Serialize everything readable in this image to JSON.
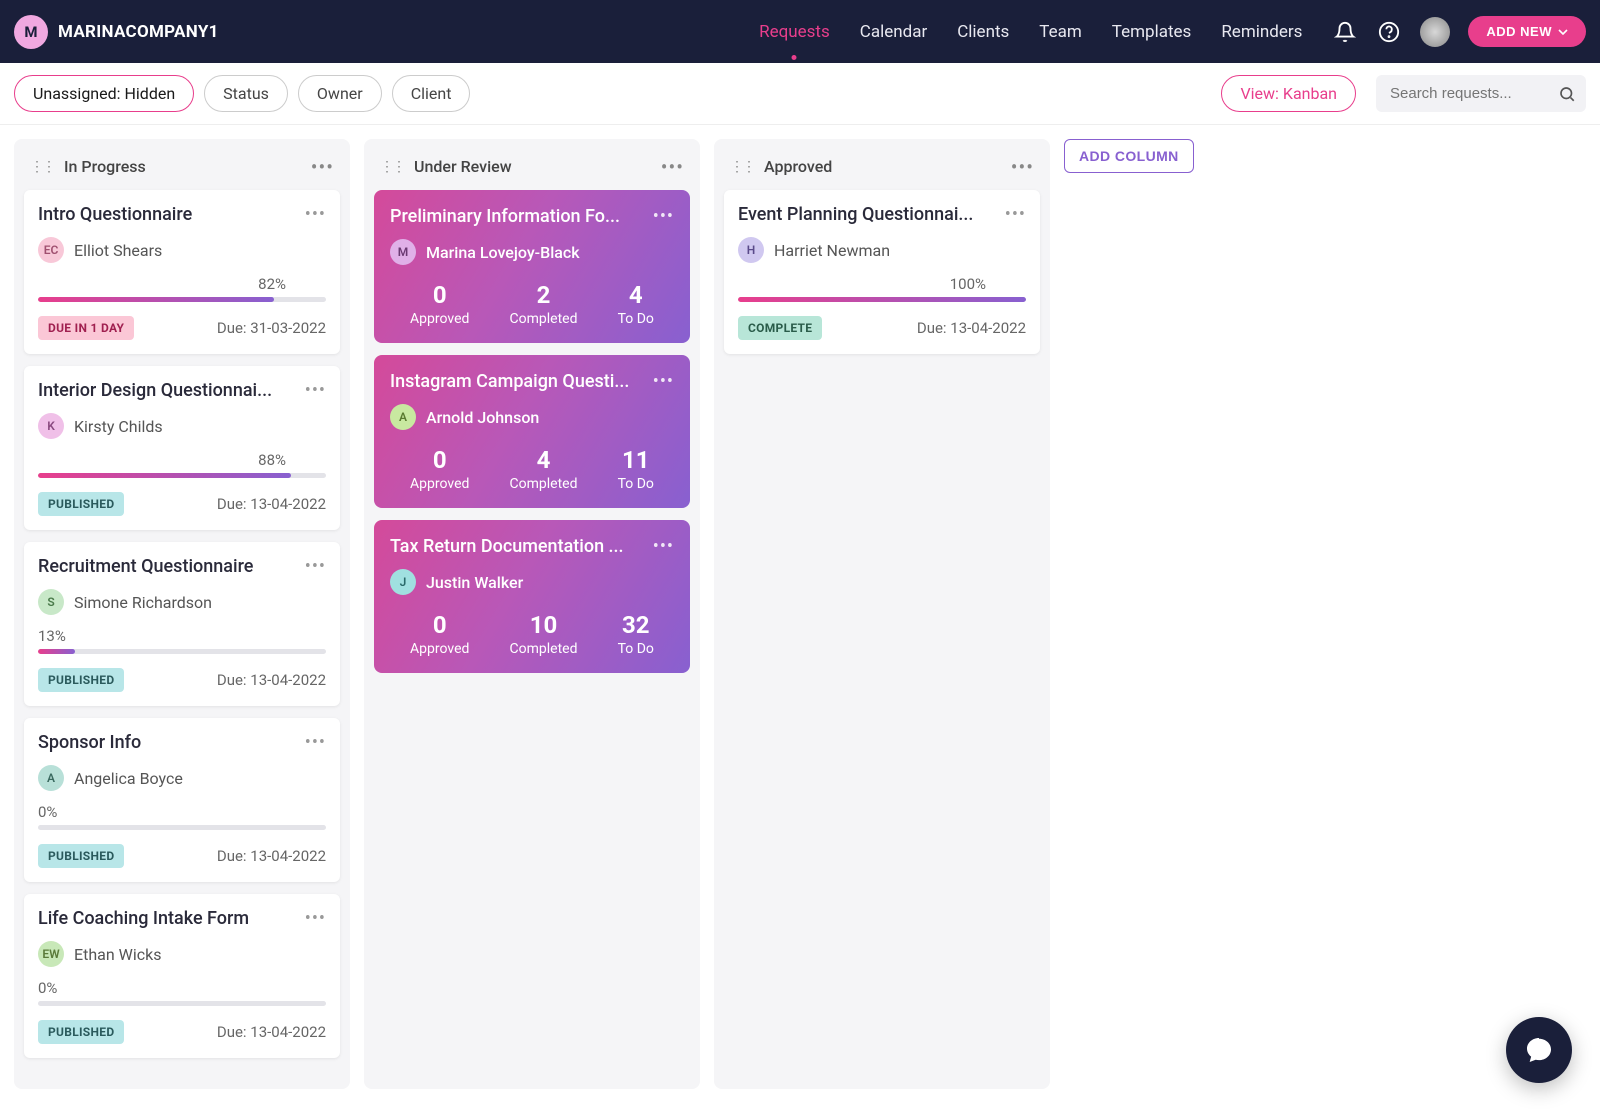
{
  "header": {
    "brand_initial": "M",
    "brand_name": "MARINACOMPANY1",
    "nav": [
      "Requests",
      "Calendar",
      "Clients",
      "Team",
      "Templates",
      "Reminders"
    ],
    "active_nav": 0,
    "add_new_label": "ADD NEW"
  },
  "filters": {
    "unassigned": "Unassigned: Hidden",
    "pills": [
      "Status",
      "Owner",
      "Client"
    ],
    "view_label": "View: Kanban",
    "search_placeholder": "Search requests..."
  },
  "board": {
    "add_column_label": "ADD COLUMN",
    "columns": [
      {
        "title": "In Progress",
        "type": "progress",
        "cards": [
          {
            "title": "Intro Questionnaire",
            "owner_initials": "EC",
            "owner_name": "Elliot Shears",
            "owner_bg": "#f8c8d8",
            "owner_fg": "#a05070",
            "pct": 82,
            "pct_label": "82%",
            "pct_align": "right",
            "status_type": "due",
            "status_label": "DUE IN 1 DAY",
            "due_prefix": "Due:",
            "due_date": "31-03-2022"
          },
          {
            "title": "Interior Design Questionnai...",
            "owner_initials": "K",
            "owner_name": "Kirsty Childs",
            "owner_bg": "#f0c0e8",
            "owner_fg": "#8a4a80",
            "pct": 88,
            "pct_label": "88%",
            "pct_align": "right",
            "status_type": "pub",
            "status_label": "PUBLISHED",
            "due_prefix": "Due:",
            "due_date": "13-04-2022"
          },
          {
            "title": "Recruitment Questionnaire",
            "owner_initials": "S",
            "owner_name": "Simone Richardson",
            "owner_bg": "#c8e8c8",
            "owner_fg": "#4a7a4a",
            "pct": 13,
            "pct_label": "13%",
            "pct_align": "left",
            "status_type": "pub",
            "status_label": "PUBLISHED",
            "due_prefix": "Due:",
            "due_date": "13-04-2022"
          },
          {
            "title": "Sponsor Info",
            "owner_initials": "A",
            "owner_name": "Angelica Boyce",
            "owner_bg": "#b8e0d8",
            "owner_fg": "#3a6a60",
            "pct": 0,
            "pct_label": "0%",
            "pct_align": "left",
            "status_type": "pub",
            "status_label": "PUBLISHED",
            "due_prefix": "Due:",
            "due_date": "13-04-2022"
          },
          {
            "title": "Life Coaching Intake Form",
            "owner_initials": "EW",
            "owner_name": "Ethan Wicks",
            "owner_bg": "#c8e8b8",
            "owner_fg": "#5a7a3a",
            "pct": 0,
            "pct_label": "0%",
            "pct_align": "left",
            "status_type": "pub",
            "status_label": "PUBLISHED",
            "due_prefix": "Due:",
            "due_date": "13-04-2022"
          }
        ]
      },
      {
        "title": "Under Review",
        "type": "review",
        "cards": [
          {
            "title": "Preliminary Information Fo...",
            "owner_initials": "M",
            "owner_name": "Marina Lovejoy-Black",
            "owner_bg": "#e0b0e8",
            "owner_fg": "#6a3a72",
            "stats": {
              "approved": 0,
              "completed": 2,
              "todo": 4
            }
          },
          {
            "title": "Instagram Campaign Questi...",
            "owner_initials": "A",
            "owner_name": "Arnold Johnson",
            "owner_bg": "#c8e8a0",
            "owner_fg": "#5a7a30",
            "stats": {
              "approved": 0,
              "completed": 4,
              "todo": 11
            }
          },
          {
            "title": "Tax Return Documentation ...",
            "owner_initials": "J",
            "owner_name": "Justin Walker",
            "owner_bg": "#a0e0e0",
            "owner_fg": "#2a6a6a",
            "stats": {
              "approved": 0,
              "completed": 10,
              "todo": 32
            }
          }
        ]
      },
      {
        "title": "Approved",
        "type": "approved",
        "cards": [
          {
            "title": "Event Planning Questionnai...",
            "owner_initials": "H",
            "owner_name": "Harriet Newman",
            "owner_bg": "#d0c8f0",
            "owner_fg": "#5a4a8a",
            "pct": 100,
            "pct_label": "100%",
            "pct_align": "right",
            "status_type": "complete",
            "status_label": "COMPLETE",
            "due_prefix": "Due:",
            "due_date": "13-04-2022"
          }
        ]
      }
    ],
    "stat_labels": {
      "approved": "Approved",
      "completed": "Completed",
      "todo": "To Do"
    }
  }
}
